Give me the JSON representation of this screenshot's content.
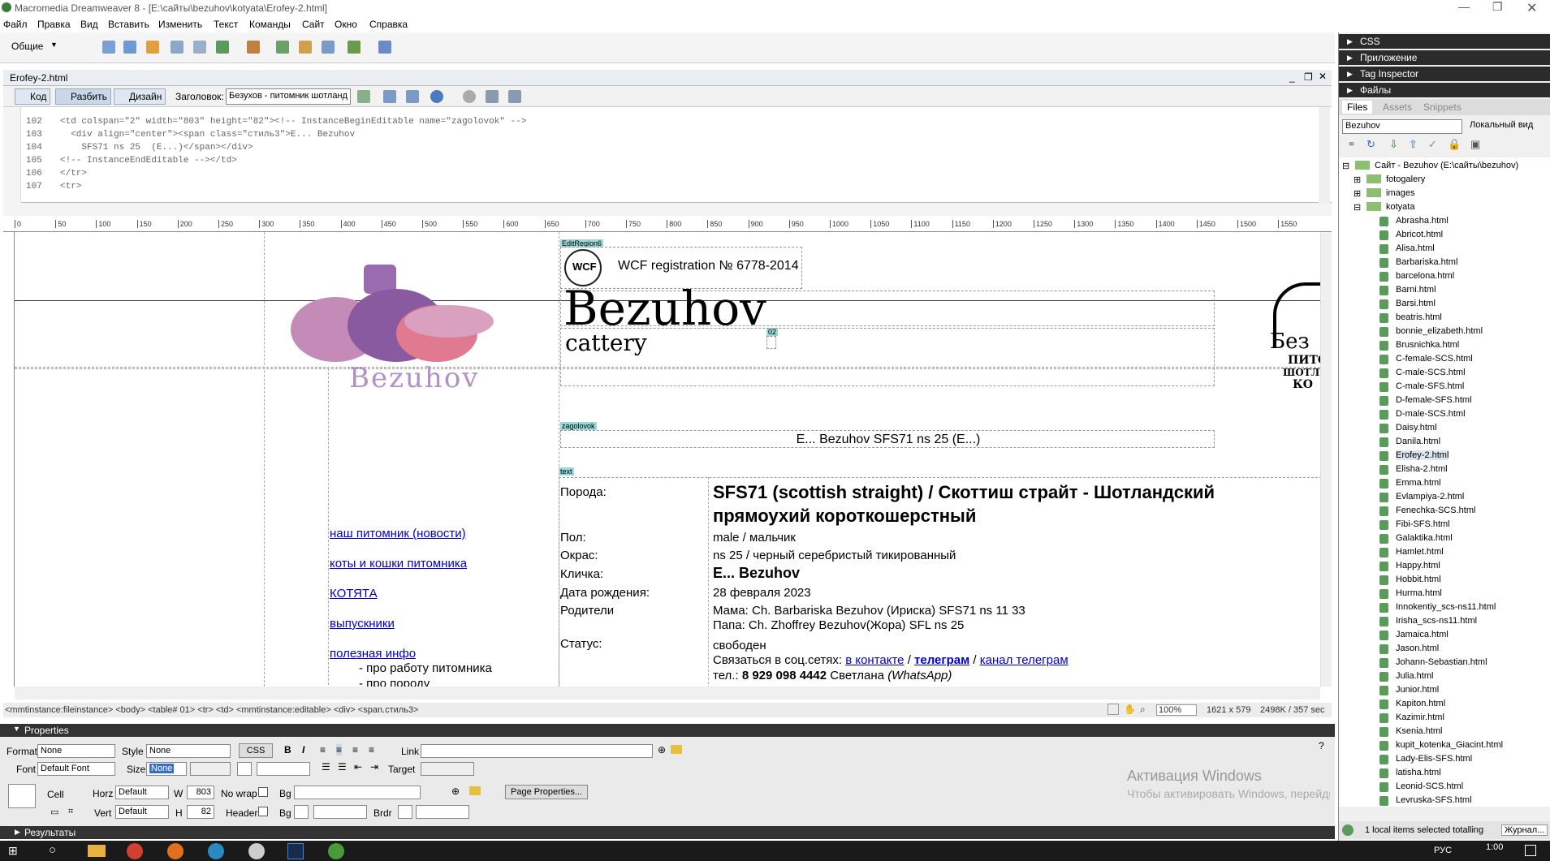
{
  "window": {
    "title": "Macromedia Dreamweaver 8 - [E:\\сайты\\bezuhov\\kotyata\\Erofey-2.html]"
  },
  "menu": [
    "Файл",
    "Правка",
    "Вид",
    "Вставить",
    "Изменить",
    "Текст",
    "Команды",
    "Сайт",
    "Окно",
    "Справка"
  ],
  "insertbar": {
    "category": "Общие"
  },
  "document": {
    "tab": "Erofey-2.html",
    "view_code": "Код",
    "view_split": "Разбить",
    "view_design": "Дизайн",
    "title_label": "Заголовок:",
    "title_value": "Безухов - питомник шотланд"
  },
  "code": [
    {
      "n": "102",
      "t": "<td colspan=\"2\" width=\"803\" height=\"82\"><!-- InstanceBeginEditable name=\"zagolovok\" -->"
    },
    {
      "n": "103",
      "t": "  <div align=\"center\"><span class=\"стиль3\">E... Bezuhov"
    },
    {
      "n": "104",
      "t": "    SFS71 ns 25  (E...)</span></div>"
    },
    {
      "n": "105",
      "t": "<!-- InstanceEndEditable --></td>"
    },
    {
      "n": "106",
      "t": "</tr>"
    },
    {
      "n": "107",
      "t": "<tr>"
    }
  ],
  "ruler": [
    "0",
    "50",
    "100",
    "150",
    "200",
    "250",
    "300",
    "350",
    "400",
    "450",
    "500",
    "550",
    "600",
    "650",
    "700",
    "750",
    "800",
    "850",
    "900",
    "950",
    "1000",
    "1050",
    "1100",
    "1150",
    "1200",
    "1250",
    "1300",
    "1350",
    "1400",
    "1450",
    "1500",
    "1550"
  ],
  "design": {
    "region_editable": "EditRegion6",
    "wcf_text": "WCF registration № 6778-2014",
    "logo_title": "Bezuhov",
    "logo_sub": "cattery",
    "region_02": "02",
    "logo_img_text": "Bezuhov",
    "region_zagolovok": "zagolovok",
    "heading": "E... Bezuhov SFS71 ns 25 (E...)",
    "region_text": "text",
    "right_logo": [
      "Без",
      "ПИТО",
      "ШОТЛ",
      "КО"
    ],
    "nav": [
      "наш питомник (новости)",
      "коты и кошки питомника",
      "КОТЯТА",
      "выпускники",
      "полезная инфо"
    ],
    "subnav": [
      "- про работу питомника",
      "- про породу"
    ],
    "rows": [
      {
        "label": "Порода:",
        "value": "SFS71 (scottish straight) / Скоттиш страйт - Шотландский прямоухий короткошерстный"
      },
      {
        "label": "Пол:",
        "value": "male / мальчик"
      },
      {
        "label": "Окрас:",
        "value": "ns 25 / черный серебристый тикированный"
      },
      {
        "label": "Кличка:",
        "value": "E... Bezuhov"
      },
      {
        "label": "Дата рождения:",
        "value": "28 февраля 2023"
      },
      {
        "label": "Родители",
        "value": "Мама: Ch. Barbariska Bezuhov (Ириска) SFS71 ns 11 33",
        "value2": "Папа: Ch. Zhoffrey Bezuhov(Жора) SFL ns 25"
      },
      {
        "label": "Статус:",
        "value": "свободен"
      }
    ],
    "contact_prefix": "Связаться в соц.сетях:",
    "contact_vk": "в контакте",
    "contact_sep1": "/",
    "contact_tg": "телеграм",
    "contact_sep2": "/",
    "contact_channel": "канал телеграм",
    "phone_prefix": "тел.:",
    "phone": "8 929 098 4442",
    "phone_name": "Светлана",
    "phone_app": "(WhatsApp)"
  },
  "statusbar": {
    "tags": "<mmtinstance:fileinstance> <body> <table#  01> <tr> <td> <mmtinstance:editable> <div> <span.стиль3>",
    "zoom": "100%",
    "size": "1621 x 579",
    "weight": "2498K / 357 sec"
  },
  "properties": {
    "header": "Properties",
    "format_label": "Format",
    "format_value": "None",
    "style_label": "Style",
    "style_value": "None",
    "css_btn": "CSS",
    "link_label": "Link",
    "font_label": "Font",
    "font_value": "Default Font",
    "size_label": "Size",
    "size_value": "None",
    "target_label": "Target",
    "cell_label": "Cell",
    "horz_label": "Horz",
    "horz_value": "Default",
    "w_label": "W",
    "w_value": "803",
    "nowrap_label": "No wrap",
    "bg_label": "Bg",
    "page_props": "Page Properties...",
    "vert_label": "Vert",
    "vert_value": "Default",
    "h_label": "H",
    "h_value": "82",
    "header_label": "Header",
    "bg2_label": "Bg",
    "brdr_label": "Brdr"
  },
  "results": "Результаты",
  "watermark": {
    "line1": "Активация Windows",
    "line2": "Чтобы активировать Windows, перейдите в раздел \"Параметры\"."
  },
  "right": {
    "panels": [
      "CSS",
      "Приложение",
      "Tag Inspector",
      "Файлы"
    ],
    "tabs": [
      "Files",
      "Assets",
      "Snippets"
    ],
    "site": "Bezuhov",
    "view": "Локальный вид",
    "tree_root": "Сайт - Bezuhov (E:\\сайты\\bezuhov)",
    "folders": [
      "fotogalery",
      "images",
      "kotyata"
    ],
    "files": [
      "Abrasha.html",
      "Abricot.html",
      "Alisa.html",
      "Barbariska.html",
      "barcelona.html",
      "Barni.html",
      "Barsi.html",
      "beatris.html",
      "bonnie_elizabeth.html",
      "Brusnichka.html",
      "C-female-SCS.html",
      "C-male-SCS.html",
      "C-male-SFS.html",
      "D-female-SFS.html",
      "D-male-SCS.html",
      "Daisy.html",
      "Danila.html",
      "Erofey-2.html",
      "Elisha-2.html",
      "Emma.html",
      "Evlampiya-2.html",
      "Fenechka-SCS.html",
      "Fibi-SFS.html",
      "Galaktika.html",
      "Hamlet.html",
      "Happy.html",
      "Hobbit.html",
      "Hurma.html",
      "Innokentiy_scs-ns11.html",
      "Irisha_scs-ns11.html",
      "Jamaica.html",
      "Jason.html",
      "Johann-Sebastian.html",
      "Julia.html",
      "Junior.html",
      "Kapiton.html",
      "Kazimir.html",
      "Ksenia.html",
      "kupit_kotenka_Giacint.html",
      "Lady-Elis-SFS.html",
      "latisha.html",
      "Leonid-SCS.html",
      "Levruska-SFS.html"
    ],
    "status": "1 local items selected totalling",
    "log": "Журнал..."
  },
  "taskbar": {
    "lang": "РУС",
    "time": "1:00"
  }
}
